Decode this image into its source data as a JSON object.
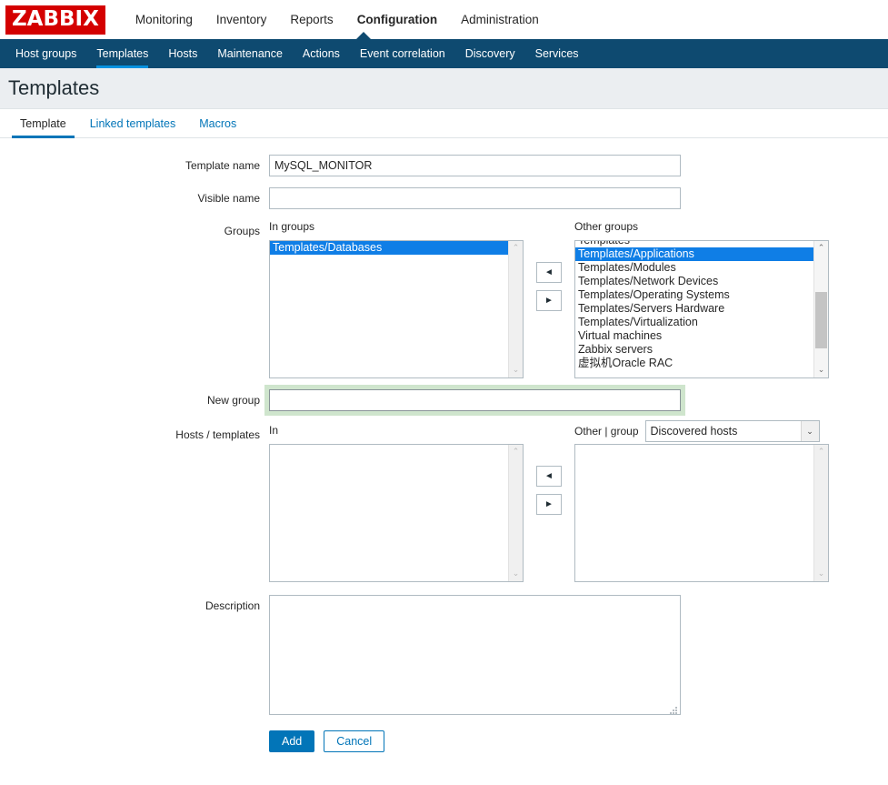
{
  "brand": {
    "logo_text": "ZABBIX",
    "logo_bg": "#d40000"
  },
  "colors": {
    "nav_bg": "#0e4a70",
    "accent": "#0275b8",
    "selected_row": "#0f7ee6",
    "focus_ring": "#cfe5cd"
  },
  "main_menu": [
    {
      "label": "Monitoring",
      "selected": false
    },
    {
      "label": "Inventory",
      "selected": false
    },
    {
      "label": "Reports",
      "selected": false
    },
    {
      "label": "Configuration",
      "selected": true
    },
    {
      "label": "Administration",
      "selected": false
    }
  ],
  "sub_menu": [
    {
      "label": "Host groups",
      "selected": false
    },
    {
      "label": "Templates",
      "selected": true
    },
    {
      "label": "Hosts",
      "selected": false
    },
    {
      "label": "Maintenance",
      "selected": false
    },
    {
      "label": "Actions",
      "selected": false
    },
    {
      "label": "Event correlation",
      "selected": false
    },
    {
      "label": "Discovery",
      "selected": false
    },
    {
      "label": "Services",
      "selected": false
    }
  ],
  "page": {
    "title": "Templates"
  },
  "tabs": [
    {
      "label": "Template",
      "selected": true
    },
    {
      "label": "Linked templates",
      "selected": false
    },
    {
      "label": "Macros",
      "selected": false
    }
  ],
  "form": {
    "template_name": {
      "label": "Template name",
      "value": "MySQL_MONITOR",
      "placeholder": ""
    },
    "visible_name": {
      "label": "Visible name",
      "value": "",
      "placeholder": ""
    },
    "groups": {
      "label": "Groups",
      "in_header": "In groups",
      "other_header": "Other groups",
      "in_items": [
        {
          "label": "Templates/Databases",
          "selected": true
        }
      ],
      "other_items": [
        {
          "label": "Templates",
          "selected": false
        },
        {
          "label": "Templates/Applications",
          "selected": true
        },
        {
          "label": "Templates/Modules",
          "selected": false
        },
        {
          "label": "Templates/Network Devices",
          "selected": false
        },
        {
          "label": "Templates/Operating Systems",
          "selected": false
        },
        {
          "label": "Templates/Servers Hardware",
          "selected": false
        },
        {
          "label": "Templates/Virtualization",
          "selected": false
        },
        {
          "label": "Virtual machines",
          "selected": false
        },
        {
          "label": "Zabbix servers",
          "selected": false
        },
        {
          "label": "虚拟机Oracle RAC",
          "selected": false
        }
      ],
      "move_left_icon": "◄",
      "move_right_icon": "►"
    },
    "new_group": {
      "label": "New group",
      "value": "",
      "placeholder": "",
      "focused": true
    },
    "hosts_templates": {
      "label": "Hosts / templates",
      "in_header": "In",
      "other_header": "Other | group",
      "group_select_value": "Discovered hosts",
      "in_items": [],
      "other_items": [],
      "move_left_icon": "◄",
      "move_right_icon": "►"
    },
    "description": {
      "label": "Description",
      "value": "",
      "placeholder": ""
    },
    "actions": {
      "add_label": "Add",
      "cancel_label": "Cancel"
    }
  },
  "icons": {
    "scroll_up": "⌃",
    "scroll_down": "⌄",
    "chevron_down": "⌄"
  }
}
